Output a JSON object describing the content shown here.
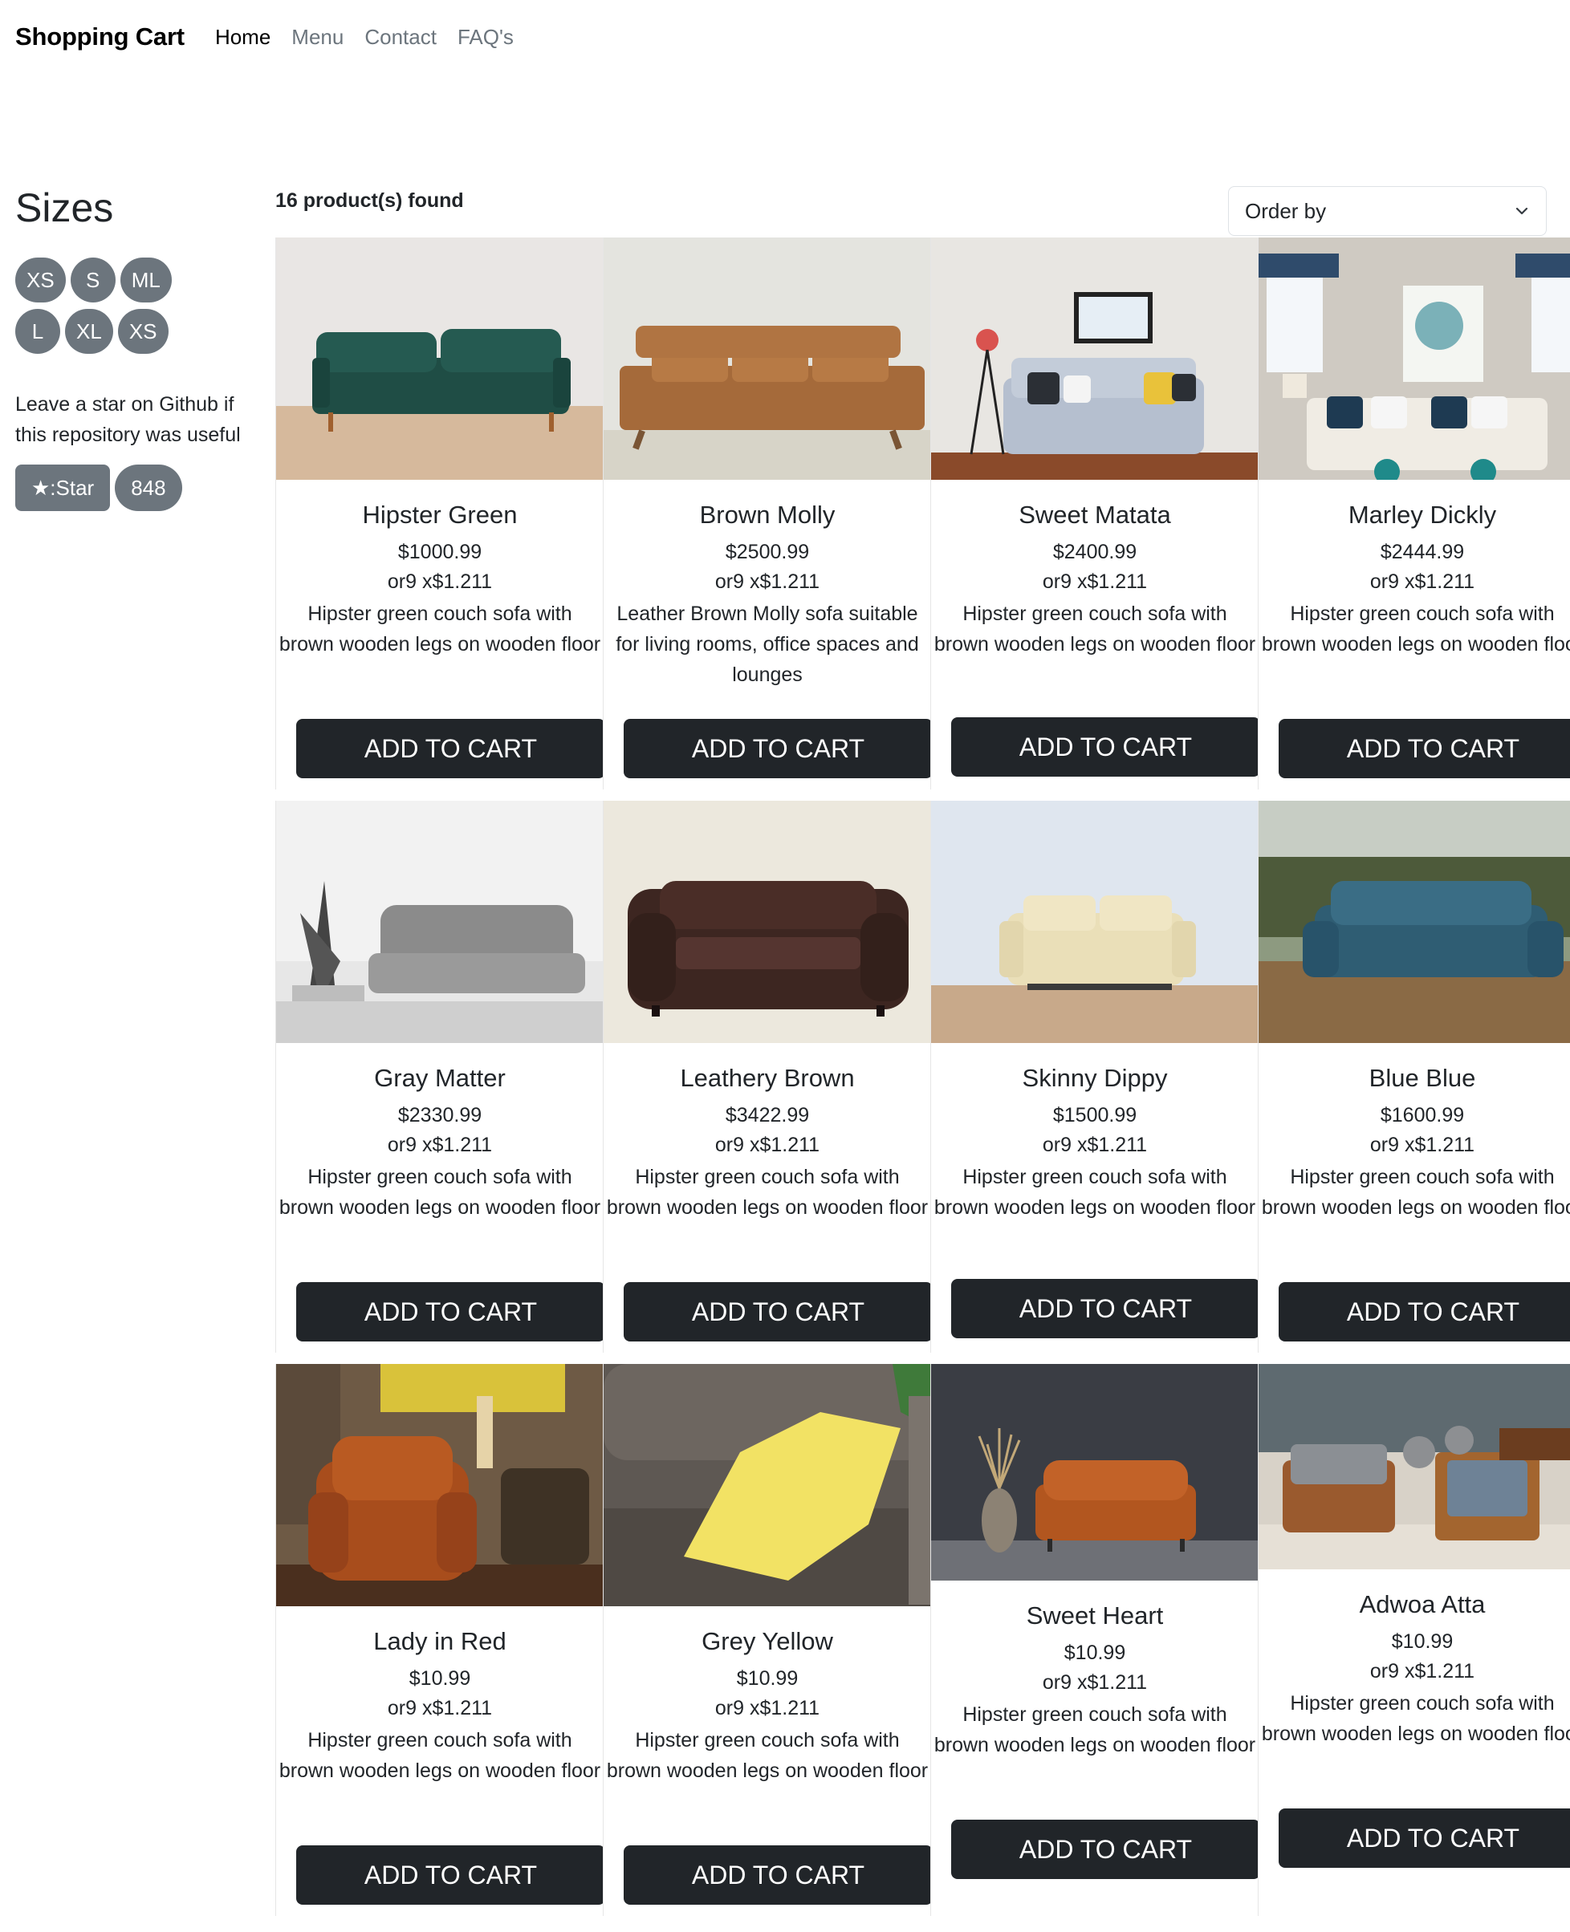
{
  "navbar": {
    "brand": "Shopping Cart",
    "links": [
      "Home",
      "Menu",
      "Contact",
      "FAQ's"
    ]
  },
  "sidebar": {
    "title": "Sizes",
    "sizes": [
      "XS",
      "S",
      "ML",
      "L",
      "XL",
      "XS"
    ],
    "github_text": "Leave a star on Github if this repository was useful",
    "star_label": "★:Star",
    "star_count": "848"
  },
  "main": {
    "found_text": "16 product(s) found",
    "order_by": "Order by"
  },
  "colors": {
    "dark_button": "#212529",
    "pill_gray": "#6c757d"
  },
  "products": [
    {
      "title": "Hipster Green",
      "price": "$1000.99",
      "installment": "or9 x$1.211",
      "description": "Hipster green couch sofa with brown wooden legs on wooden floor",
      "button": "ADD TO CART",
      "image": "green-velvet-sofa"
    },
    {
      "title": "Brown Molly",
      "price": "$2500.99",
      "installment": "or9 x$1.211",
      "description": "Leather Brown Molly sofa suitable for living rooms, office spaces and lounges",
      "button": "ADD TO CART",
      "image": "tan-leather-sofa"
    },
    {
      "title": "Sweet Matata",
      "price": "$2400.99",
      "installment": "or9 x$1.211",
      "description": "Hipster green couch sofa with brown wooden legs on wooden floor",
      "button": "ADD TO CART",
      "image": "light-blue-sofa-with-pillows"
    },
    {
      "title": "Marley Dickly",
      "price": "$2444.99",
      "installment": "or9 x$1.211",
      "description": "Hipster green couch sofa with brown wooden legs on wooden floor",
      "button": "ADD TO CART",
      "image": "white-sofa-living-room"
    },
    {
      "title": "Gray Matter",
      "price": "$2330.99",
      "installment": "or9 x$1.211",
      "description": "Hipster green couch sofa with brown wooden legs on wooden floor",
      "button": "ADD TO CART",
      "image": "gray-channel-sofa"
    },
    {
      "title": "Leathery Brown",
      "price": "$3422.99",
      "installment": "or9 x$1.211",
      "description": "Hipster green couch sofa with brown wooden legs on wooden floor",
      "button": "ADD TO CART",
      "image": "chesterfield-sofa"
    },
    {
      "title": "Skinny Dippy",
      "price": "$1500.99",
      "installment": "or9 x$1.211",
      "description": "Hipster green couch sofa with brown wooden legs on wooden floor",
      "button": "ADD TO CART",
      "image": "cream-sofa"
    },
    {
      "title": "Blue Blue",
      "price": "$1600.99",
      "installment": "or9 x$1.211",
      "description": "Hipster green couch sofa with brown wooden legs on wooden floor",
      "button": "ADD TO CART",
      "image": "blue-sofa-outdoors"
    },
    {
      "title": "Lady in Red",
      "price": "$10.99",
      "installment": "or9 x$1.211",
      "description": "Hipster green couch sofa with brown wooden legs on wooden floor",
      "button": "ADD TO CART",
      "image": "orange-leather-armchair"
    },
    {
      "title": "Grey Yellow",
      "price": "$10.99",
      "installment": "or9 x$1.211",
      "description": "Hipster green couch sofa with brown wooden legs on wooden floor",
      "button": "ADD TO CART",
      "image": "gray-sofa-yellow-pillow"
    },
    {
      "title": "Sweet Heart",
      "price": "$10.99",
      "installment": "or9 x$1.211",
      "description": "Hipster green couch sofa with brown wooden legs on wooden floor",
      "button": "ADD TO CART",
      "image": "rust-tufted-sofa"
    },
    {
      "title": "Adwoa Atta",
      "price": "$10.99",
      "installment": "or9 x$1.211",
      "description": "Hipster green couch sofa with brown wooden legs on wooden floor",
      "button": "ADD TO CART",
      "image": "wooden-armchairs-room"
    }
  ]
}
